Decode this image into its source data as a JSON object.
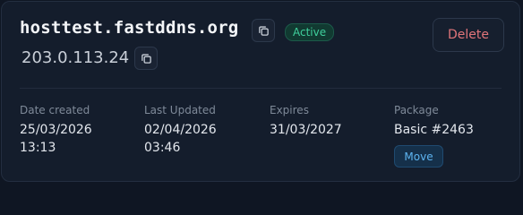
{
  "record": {
    "hostname": "hosttest.fastddns.org",
    "status": "Active",
    "ip": "203.0.113.24",
    "delete_label": "Delete"
  },
  "details": {
    "created": {
      "label": "Date created",
      "date": "25/03/2026",
      "time": "13:13"
    },
    "updated": {
      "label": "Last Updated",
      "date": "02/04/2026",
      "time": "03:46"
    },
    "expires": {
      "label": "Expires",
      "date": "31/03/2027"
    },
    "package": {
      "label": "Package",
      "value": "Basic #2463",
      "move_label": "Move"
    }
  },
  "icons": {
    "copy_hostname": "copy-icon",
    "copy_ip": "copy-icon"
  },
  "colors": {
    "card_background": "#141d2c",
    "status_active": "#3fcf9c",
    "delete_text": "#e0757a",
    "move_accent": "#5db4f0"
  }
}
